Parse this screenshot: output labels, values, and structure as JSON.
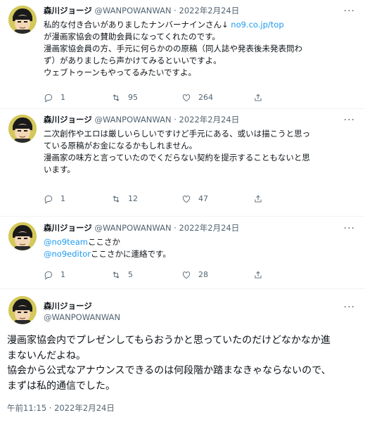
{
  "tweets": [
    {
      "name": "森川ジョージ",
      "handle": "@WANPOWANWAN",
      "dot": "·",
      "date": "2022年2月24日",
      "line1_prefix": "私的な付き合いがありましたナンバーナインさん↓ ",
      "line1_link": "no9.co.jp/top",
      "lines": [
        "が漫画家協会の賛助会員になってくれたのです。",
        "漫画家協会員の方、手元に何らかのの原稿（同人誌や発表後未発表問わ",
        "ず）がありましたら声かけてみるといいですよ。",
        "ウェブトゥーンもやってるみたいですよ。"
      ],
      "replies": "1",
      "retweets": "95",
      "likes": "264"
    },
    {
      "name": "森川ジョージ",
      "handle": "@WANPOWANWAN",
      "dot": "·",
      "date": "2022年2月24日",
      "lines": [
        "二次創作やエロは厳しいらしいですけど手元にある、或いは描こうと思っ",
        "ている原稿がお金になるかもしれません。",
        "漫画家の味方と言っていたのでくだらない契約を提示することもないと思",
        "います。"
      ],
      "replies": "1",
      "retweets": "12",
      "likes": "47"
    },
    {
      "name": "森川ジョージ",
      "handle": "@WANPOWANWAN",
      "dot": "·",
      "date": "2022年2月24日",
      "mention1": "@no9team",
      "mention1_rest": "ここさか",
      "mention2": "@no9editor",
      "mention2_rest": "ここさかに連絡です。",
      "replies": "1",
      "retweets": "5",
      "likes": "28"
    }
  ],
  "main_tweet": {
    "name": "森川ジョージ",
    "handle": "@WANPOWANWAN",
    "lines": [
      "漫画家協会内でプレゼンしてもらおうかと思っていたのだけどなかなか進",
      "まないんだよね。",
      "協会から公式なアナウンスできるのは何段階か踏まなきゃならないので、",
      "まずは私的通信でした。"
    ],
    "timestamp": "午前11:15 · 2022年2月24日"
  },
  "icons": {
    "reply": "reply-icon",
    "retweet": "retweet-icon",
    "like": "heart-icon",
    "share": "share-icon",
    "more": "more-icon"
  },
  "colors": {
    "link": "#1d9bf0",
    "secondary_text": "#536471",
    "divider": "#eff3f4"
  }
}
